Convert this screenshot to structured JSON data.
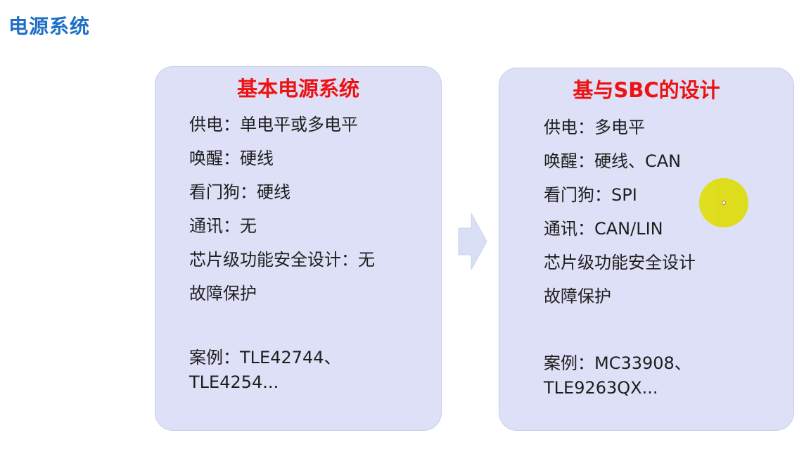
{
  "page": {
    "title": "电源系统"
  },
  "cards": [
    {
      "title": "基本电源系统",
      "features": [
        "供电：单电平或多电平",
        "唤醒：硬线",
        "看门狗：硬线",
        "通讯：无",
        "芯片级功能安全设计：无",
        "故障保护"
      ],
      "example": {
        "line1": "案例：TLE42744、",
        "line2": "TLE4254..."
      }
    },
    {
      "title": "基与SBC的设计",
      "features": [
        "供电：多电平",
        "唤醒：硬线、CAN",
        "看门狗：SPI",
        "通讯：CAN/LIN",
        "芯片级功能安全设计",
        "故障保护"
      ],
      "example": {
        "line1": "案例：MC33908、",
        "line2": "TLE9263QX..."
      }
    }
  ],
  "icons": {
    "arrow": "arrow-right-icon",
    "pointer": "laser-pointer-icon"
  },
  "colors": {
    "page_title": "#1f6fc5",
    "card_title": "#ee1111",
    "card_background": "#dde0f6",
    "arrow": "#d9dff5",
    "pointer": "#dedd0c"
  }
}
